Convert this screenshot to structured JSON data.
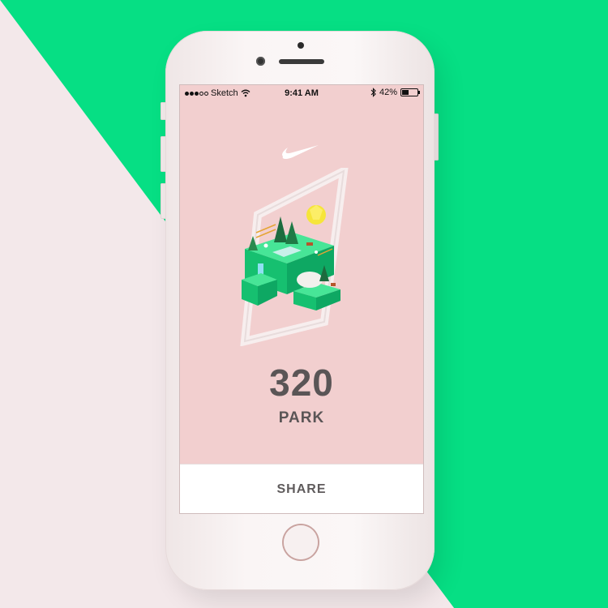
{
  "status_bar": {
    "carrier": "Sketch",
    "time": "9:41 AM",
    "battery": "42%",
    "battery_level": 0.42
  },
  "main": {
    "score": "320",
    "place": "PARK"
  },
  "actions": {
    "share_label": "SHARE"
  },
  "icons": [
    "signal-dots-icon",
    "wifi-icon",
    "bluetooth-icon",
    "battery-icon",
    "nike-swoosh-icon",
    "park-illustration"
  ],
  "colors": {
    "background_green": "#06df84",
    "background_pink": "#f3e8ea",
    "screen_pink": "#f2cfcf",
    "text_gray": "#5a5556"
  }
}
